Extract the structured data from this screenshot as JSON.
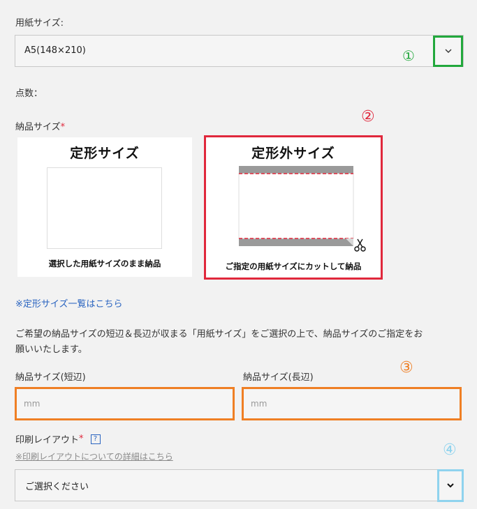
{
  "paper_size": {
    "label": "用紙サイズ:",
    "selected": "A5(148×210)",
    "chevron": "chevron-down-icon",
    "callout": "①",
    "callout_color": "#22a83c"
  },
  "quantity": {
    "label": "点数："
  },
  "delivery_size": {
    "label": "納品サイズ",
    "required_mark": "*",
    "callout": "②",
    "callout_color": "#e0283c",
    "options": [
      {
        "title": "定形サイズ",
        "caption": "選択した用紙サイズのまま納品"
      },
      {
        "title": "定形外サイズ",
        "caption": "ご指定の用紙サイズにカットして納品"
      }
    ],
    "scissors_icon": "scissors-icon"
  },
  "standard_sizes_link": "※定形サイズ一覧はこちら",
  "description": {
    "line1": "ご希望の納品サイズの短辺＆長辺が収まる「用紙サイズ」をご選択の上で、納品サイズのご指定をお",
    "line2": "願いいたします。"
  },
  "dimensions": {
    "callout": "③",
    "callout_color": "#ef7f24",
    "short_label": "納品サイズ(短辺)",
    "short_placeholder": "mm",
    "long_label": "納品サイズ(長辺)",
    "long_placeholder": "mm"
  },
  "print_layout": {
    "label": "印刷レイアウト",
    "required_mark": "*",
    "help": "?",
    "details_link": "※印刷レイアウトについての詳細はこちら",
    "selected": "ご選択ください",
    "chevron": "chevron-down-icon",
    "callout": "④",
    "callout_color": "#8fd3ee"
  }
}
